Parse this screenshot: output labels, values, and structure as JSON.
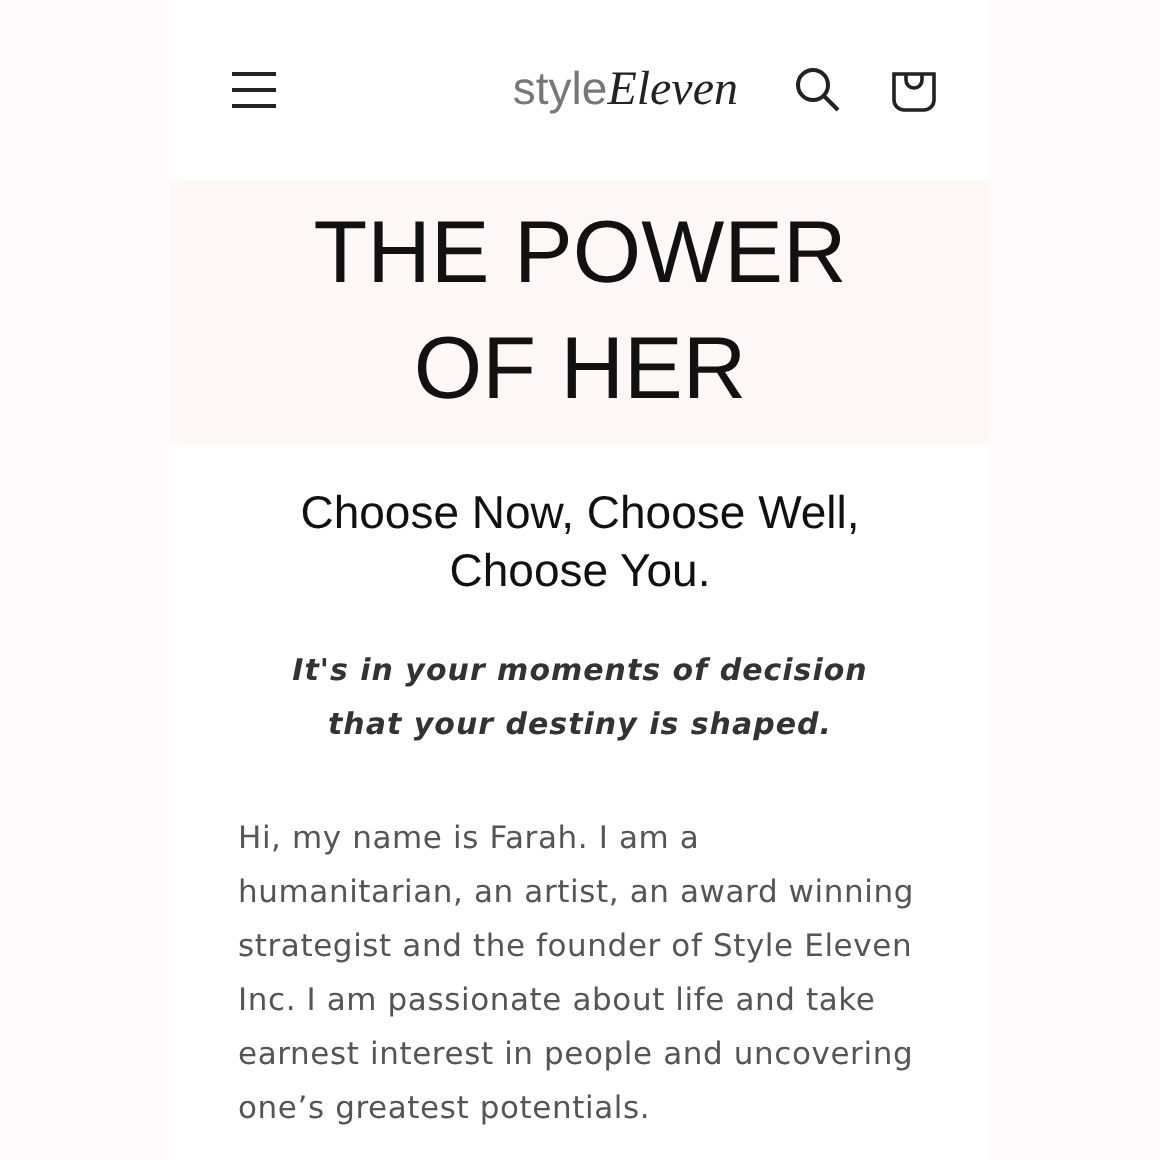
{
  "header": {
    "logo": {
      "prefix": "style",
      "name": "Eleven"
    }
  },
  "hero": {
    "title": "THE POWER OF HER"
  },
  "intro": {
    "subtitle": "Choose Now, Choose Well, Choose You.",
    "tagline": "It's in your moments of decision that your destiny is shaped.",
    "paragraph": "Hi, my name is Farah.  I am a humanitarian, an artist, an award winning strategist and the founder of Style Eleven Inc.  I am passionate about life and take earnest interest in people and uncovering one’s greatest potentials."
  }
}
